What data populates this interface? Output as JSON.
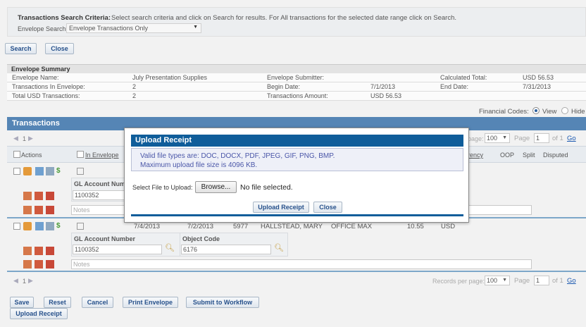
{
  "criteria": {
    "heading": "Transactions Search Criteria:",
    "instructions": "Select search criteria and click on Search for results. For All transactions for the selected date range click on Search.",
    "envelope_search_label": "Envelope Search:",
    "envelope_search_value": "Envelope Transactions Only"
  },
  "top_buttons": {
    "search": "Search",
    "close": "Close"
  },
  "summary": {
    "title": "Envelope Summary",
    "envelope_name_label": "Envelope Name:",
    "envelope_name": "July Presentation Supplies",
    "transactions_label": "Transactions In Envelope:",
    "transactions_count": "2",
    "total_usd_label": "Total USD Transactions:",
    "total_usd_count": "2",
    "submitter_label": "Envelope Submitter:",
    "begin_label": "Begin Date:",
    "begin_date": "7/1/2013",
    "amount_label": "Transactions Amount:",
    "amount_value": "USD 56.53",
    "calc_total_label": "Calculated Total:",
    "calc_total_value": "USD 56.53",
    "end_label": "End Date:",
    "end_date": "7/31/2013"
  },
  "financial_codes": {
    "label": "Financial Codes:",
    "view": "View",
    "hide": "Hide"
  },
  "transactions": {
    "title": "Transactions",
    "pager_page": "1",
    "records_per_page_label": "Records per page:",
    "records_per_page_label_short": "page:",
    "records_per_page_value": "100",
    "page_label": "Page",
    "page_value": "1",
    "of_label": "of 1",
    "go_label": "Go",
    "headers": {
      "actions": "Actions",
      "in_envelope": "In Envelope",
      "currency": "rency",
      "oop": "OOP",
      "split": "Split",
      "disputed": "Disputed"
    },
    "gl_account_label": "GL Account Number",
    "gl_account_label_cut": "GL Account Numb",
    "object_code_label": "Object Code",
    "notes_placeholder": "Notes",
    "row1": {
      "gl_account": "1100352"
    },
    "row2": {
      "trans_date": "7/4/2013",
      "post_date": "7/2/2013",
      "card": "5977",
      "cardholder": "HALLSTEAD, MARY",
      "merchant": "OFFICE MAX",
      "amount": "10.55",
      "currency": "USD",
      "gl_account": "1100352",
      "object_code": "6176"
    }
  },
  "bottom_buttons": {
    "save": "Save",
    "reset": "Reset",
    "cancel": "Cancel",
    "print": "Print Envelope",
    "submit": "Submit to Workflow",
    "upload": "Upload Receipt"
  },
  "modal": {
    "title": "Upload Receipt",
    "info_line1": "Valid file types are: DOC, DOCX, PDF, JPEG, GIF, PNG, BMP.",
    "info_line2": "Maximum upload file size is 4096 KB.",
    "select_label": "Select File to Upload:",
    "browse": "Browse...",
    "no_file": "No file selected.",
    "upload_button": "Upload Receipt",
    "close_button": "Close"
  },
  "colors": {
    "header_blue": "#5585b5",
    "modal_blue": "#0f5d9a",
    "link_blue": "#1a58b0",
    "info_text": "#4a56a8"
  }
}
